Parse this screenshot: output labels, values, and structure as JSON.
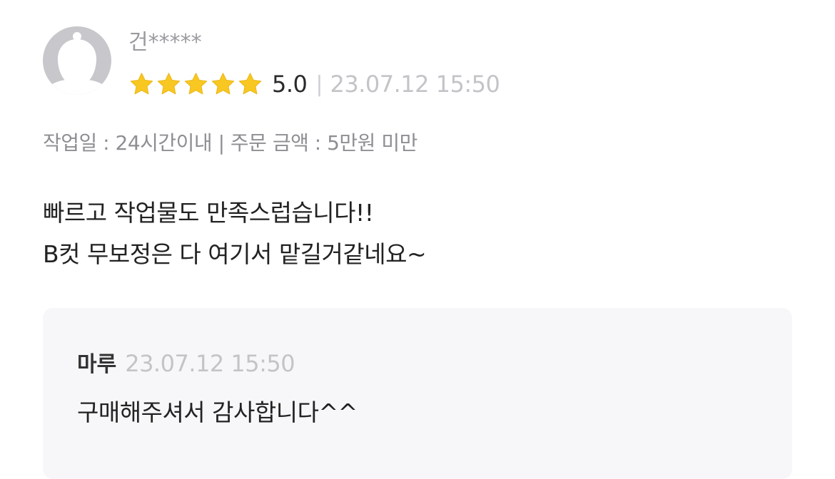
{
  "review": {
    "username": "건*****",
    "avatar_icon": "default-profile-icon",
    "star_icon": "star-icon",
    "star_color": "#F8C721",
    "rating": {
      "stars_filled": 5,
      "stars_total": 5,
      "score": "5.0"
    },
    "separator": "|",
    "date": "23.07.12 15:50",
    "meta": "작업일 : 24시간이내 | 주문 금액 : 5만원 미만",
    "body_lines": [
      "빠르고 작업물도 만족스럽습니다!!",
      "B컷 무보정은 다 여기서 맡길거같네요~"
    ]
  },
  "reply": {
    "author": "마루",
    "date": "23.07.12 15:50",
    "text": "구매해주셔서 감사합니다^^"
  }
}
